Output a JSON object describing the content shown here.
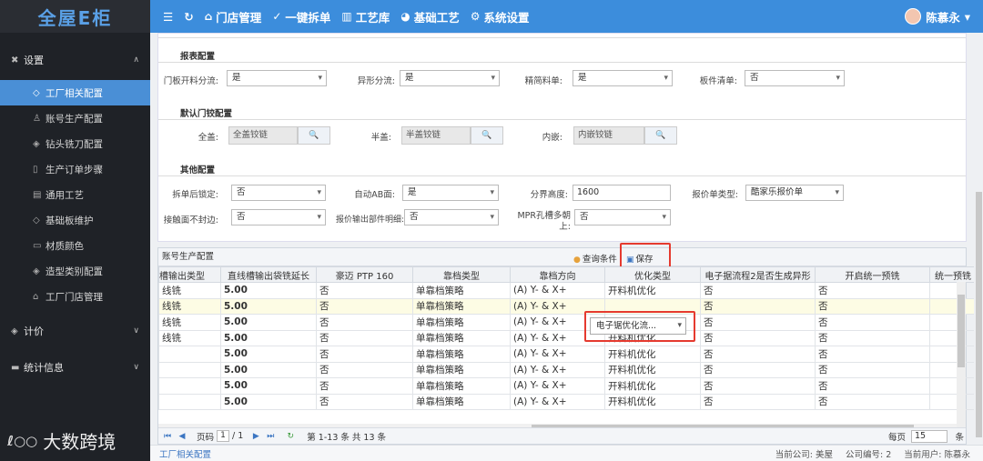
{
  "sidebar": {
    "logo": "全屋E柜",
    "groups": [
      {
        "label": "设置",
        "chevron": "∧"
      },
      {
        "label": "计价",
        "chevron": "∨"
      },
      {
        "label": "统计信息",
        "chevron": "∨"
      }
    ],
    "items": [
      {
        "label": "工厂相关配置",
        "icon": "tag-icon"
      },
      {
        "label": "账号生产配置",
        "icon": "user-icon"
      },
      {
        "label": "钻头铣刀配置",
        "icon": "diamond-icon"
      },
      {
        "label": "生产订单步骤",
        "icon": "columns-icon"
      },
      {
        "label": "通用工艺",
        "icon": "list-icon"
      },
      {
        "label": "基础板维护",
        "icon": "tag-icon"
      },
      {
        "label": "材质颜色",
        "icon": "image-icon"
      },
      {
        "label": "造型类别配置",
        "icon": "diamond-icon"
      },
      {
        "label": "工厂门店管理",
        "icon": "home-icon"
      }
    ],
    "watermark": "大数跨境"
  },
  "topbar": {
    "nav": [
      {
        "label": "门店管理",
        "icon": "home-icon"
      },
      {
        "label": "一键拆单",
        "icon": "check-circle-icon"
      },
      {
        "label": "工艺库",
        "icon": "book-icon"
      },
      {
        "label": "基础工艺",
        "icon": "palette-icon"
      },
      {
        "label": "系统设置",
        "icon": "gear-icon"
      }
    ],
    "user": "陈慕永"
  },
  "form": {
    "report_title": "报表配置",
    "report_fields": [
      {
        "label": "门板开料分流:",
        "value": "是"
      },
      {
        "label": "异形分流:",
        "value": "是"
      },
      {
        "label": "精简料单:",
        "value": "是"
      },
      {
        "label": "板件清单:",
        "value": "否"
      }
    ],
    "hinge_title": "默认门铰配置",
    "hinge_fields": [
      {
        "label": "全盖:",
        "value": "全盖铰链"
      },
      {
        "label": "半盖:",
        "value": "半盖铰链"
      },
      {
        "label": "内嵌:",
        "value": "内嵌铰链"
      }
    ],
    "other_title": "其他配置",
    "other_fields": [
      {
        "label": "拆单后锁定:",
        "value": "否"
      },
      {
        "label": "自动AB面:",
        "value": "是"
      },
      {
        "label": "分界高度:",
        "value": "1600"
      },
      {
        "label": "报价单类型:",
        "value": "酷家乐报价单"
      },
      {
        "label": "接触面不封边:",
        "value": "否"
      },
      {
        "label": "报价输出部件明细:",
        "value": "否"
      },
      {
        "label": "MPR孔槽多朝上:",
        "value": "否"
      }
    ]
  },
  "grid": {
    "title": "账号生产配置",
    "query_label": "查询条件",
    "save_label": "保存",
    "columns": [
      "槽输出类型",
      "直线槽输出袋铣延长",
      "豪迈 PTP 160",
      "靠档类型",
      "靠档方向",
      "优化类型",
      "电子据流程2是否生成异形",
      "开启统一预铣",
      "统一预铣"
    ],
    "rows": [
      [
        "线铣",
        "5.00",
        "否",
        "单靠档策略",
        "(A) Y- & X+",
        "开料机优化",
        "否",
        "否",
        ""
      ],
      [
        "线铣",
        "5.00",
        "否",
        "单靠档策略",
        "(A) Y- & X+",
        "",
        "否",
        "否",
        ""
      ],
      [
        "线铣",
        "5.00",
        "否",
        "单靠档策略",
        "(A) Y- & X+",
        "开料机优化",
        "否",
        "否",
        ""
      ],
      [
        "线铣",
        "5.00",
        "否",
        "单靠档策略",
        "(A) Y- & X+",
        "开料机优化",
        "否",
        "否",
        ""
      ],
      [
        "",
        "5.00",
        "否",
        "单靠档策略",
        "(A) Y- & X+",
        "开料机优化",
        "否",
        "否",
        ""
      ],
      [
        "",
        "5.00",
        "否",
        "单靠档策略",
        "(A) Y- & X+",
        "开料机优化",
        "否",
        "否",
        ""
      ],
      [
        "",
        "5.00",
        "否",
        "单靠档策略",
        "(A) Y- & X+",
        "开料机优化",
        "否",
        "否",
        ""
      ],
      [
        "",
        "5.00",
        "否",
        "单靠档策略",
        "(A) Y- & X+",
        "开料机优化",
        "否",
        "否",
        ""
      ]
    ],
    "editing_value": "电子锯优化流...",
    "pager": {
      "page_label": "页码",
      "page": "1",
      "of": "/ 1",
      "range": "第 1-13 条  共 13 条",
      "per_page_label": "每页",
      "per_page": "15",
      "tail": "条"
    }
  },
  "status": {
    "page": "工厂相关配置",
    "company": "当前公司: 美屋",
    "company_no": "公司编号: 2",
    "user": "当前用户: 陈慕永"
  },
  "colors": {
    "accent": "#3c8ddc",
    "sidebar": "#1f2227",
    "highlight": "#e53a2f"
  }
}
